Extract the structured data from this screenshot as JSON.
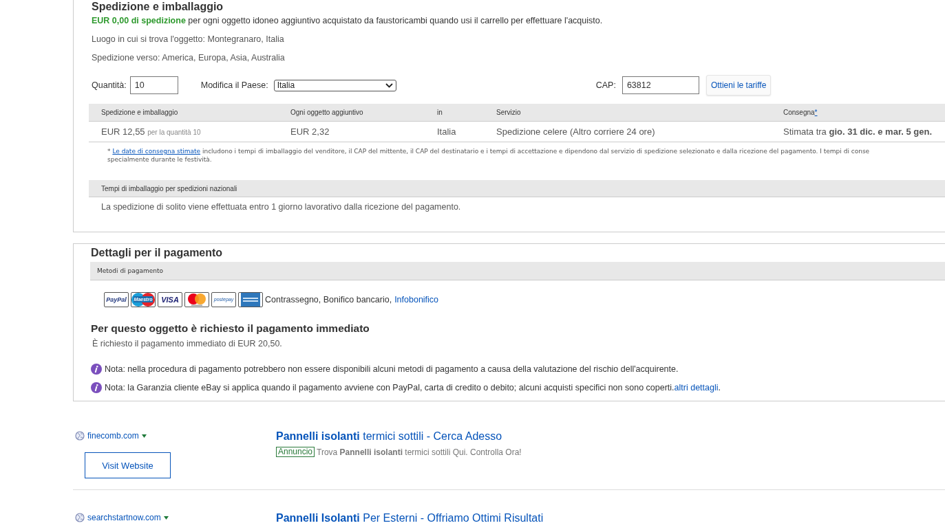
{
  "shipping": {
    "title": "Spedizione e imballaggio",
    "free_line": "**EUR 0,00 di spedizione** per ogni oggetto idoneo aggiuntivo acquistato da faustoricambi quando usi il carrello per effettuare l'acquisto.",
    "location": "Luogo in cui si trova l'oggetto: Montegranaro, Italia",
    "ships_to": "Spedizione verso: America, Europa, Asia, Australia",
    "quantity": {
      "label": "Quantità:",
      "value": "10"
    },
    "country": {
      "label": "Modifica il Paese:",
      "value": "Italia"
    },
    "zip": {
      "label": "CAP:",
      "value": "63812"
    },
    "rates_button": "Ottieni le tariffe",
    "table": {
      "columns": [
        "Spedizione e imballaggio",
        "Ogni oggetto aggiuntivo",
        "in",
        "Servizio",
        "Consegna"
      ],
      "footnote_mark": "*",
      "rows": [
        {
          "cost": "EUR 12,55",
          "cost_note": "per la quantità 10",
          "each_additional": "EUR 2,32",
          "to": "Italia",
          "service": "Spedizione celere (Altro corriere 24 ore)",
          "delivery": "Stimata tra **gio. 31 dic. e mar. 5 gen.**"
        }
      ]
    },
    "footnote": {
      "mark": "*",
      "link": "Le date di consegna stimate",
      "line_1": "includono i tempi di imballaggio del venditore, il CAP del mittente, il CAP del destinatario e i tempi di accettazione e dipendono dal servizio di spedizione selezionato e dalla ricezione del pagamento. I tempi di conse",
      "line_2": "specialmente durante le festività."
    },
    "handling": {
      "heading": "Tempi di imballaggio per spedizioni nazionali",
      "text": "La spedizione di solito viene effettuata entro 1 giorno lavorativo dalla ricezione del pagamento."
    }
  },
  "payment": {
    "title": "Dettagli per il pagamento",
    "methods_heading": "Metodi di pagamento",
    "logos": [
      {
        "kind": "paypal",
        "label": "PayPal"
      },
      {
        "kind": "maestro",
        "label": "Maestro"
      },
      {
        "kind": "visa",
        "label": "VISA"
      },
      {
        "kind": "mastercard"
      },
      {
        "kind": "postepay",
        "label": "postepay"
      },
      {
        "kind": "amex"
      }
    ],
    "other_methods": "Contrassegno, Bonifico bancario,",
    "other_link": "Infobonifico",
    "immediate_title": "Per questo oggetto è richiesto il pagamento immediato",
    "immediate_text": "È richiesto il pagamento immediato di EUR 20,50.",
    "notes": [
      {
        "text": "Nota: nella procedura di pagamento potrebbero non essere disponibili alcuni metodi di pagamento a causa della valutazione del rischio dell'acquirente."
      },
      {
        "text": "Nota: la Garanzia cliente eBay si applica quando il pagamento avviene con PayPal, carta di credito o debito; alcuni acquisti specifici non sono coperti.",
        "link": "altri dettagli",
        "after": "."
      }
    ]
  },
  "ads": [
    {
      "domain": "finecomb.com",
      "button": "Visit Website",
      "title": "**Pannelli isolanti** termici sottili - Cerca Adesso",
      "badge": "Annuncio",
      "description": "Trova **Pannelli isolanti** termici sottili Qui. Controlla Ora!"
    },
    {
      "domain": "searchstartnow.com",
      "title": "**Pannelli Isolanti** Per Esterni - Offriamo Ottimi Risultati"
    }
  ]
}
